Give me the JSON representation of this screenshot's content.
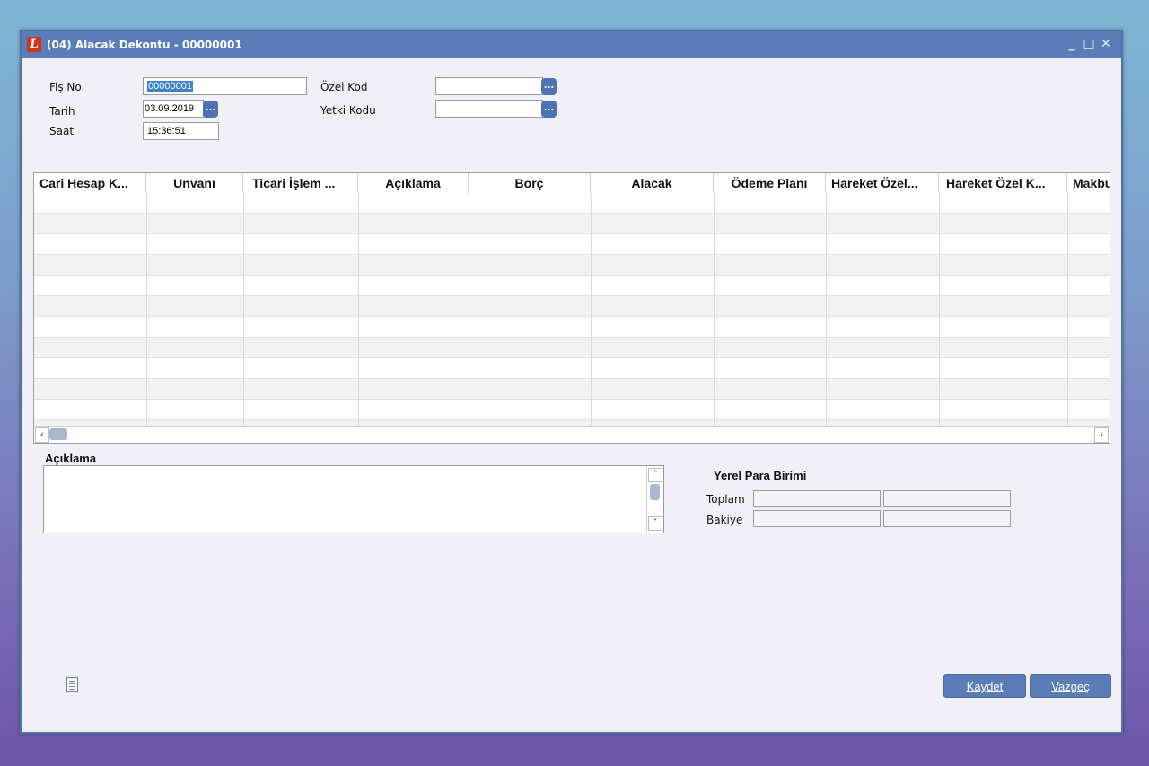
{
  "window": {
    "title": "(04) Alacak Dekontu - 00000001",
    "icon_letter": "L",
    "controls": {
      "minimize": "_",
      "maximize": "□",
      "close": "✕"
    }
  },
  "form": {
    "fis_no": {
      "label": "Fiş No.",
      "value": "00000001"
    },
    "tarih": {
      "label": "Tarih",
      "value": "03.09.2019"
    },
    "saat": {
      "label": "Saat",
      "value": "15:36:51"
    },
    "ozel_kod": {
      "label": "Özel Kod",
      "value": ""
    },
    "yetki_kodu": {
      "label": "Yetki Kodu",
      "value": ""
    },
    "lookup_label": "..."
  },
  "grid": {
    "columns": [
      "Cari Hesap K...",
      "Unvanı",
      "Ticari İşlem ...",
      "Açıklama",
      "Borç",
      "Alacak",
      "Ödeme Planı",
      "Hareket Özel...",
      "Hareket Özel K...",
      "Makbuz"
    ],
    "scroll_left": "‹",
    "scroll_right": "›"
  },
  "notes": {
    "label": "Açıklama",
    "value": "",
    "scroll_up": "˄",
    "scroll_down": "˅"
  },
  "summary": {
    "title": "Yerel Para Birimi",
    "toplam_label": "Toplam",
    "bakiye_label": "Bakiye"
  },
  "buttons": {
    "save": "Kaydet",
    "cancel": "Vazgeç"
  },
  "colors": {
    "titlebar": "#5a7db8",
    "button": "#5a7db8",
    "app_icon": "#d4321f"
  }
}
